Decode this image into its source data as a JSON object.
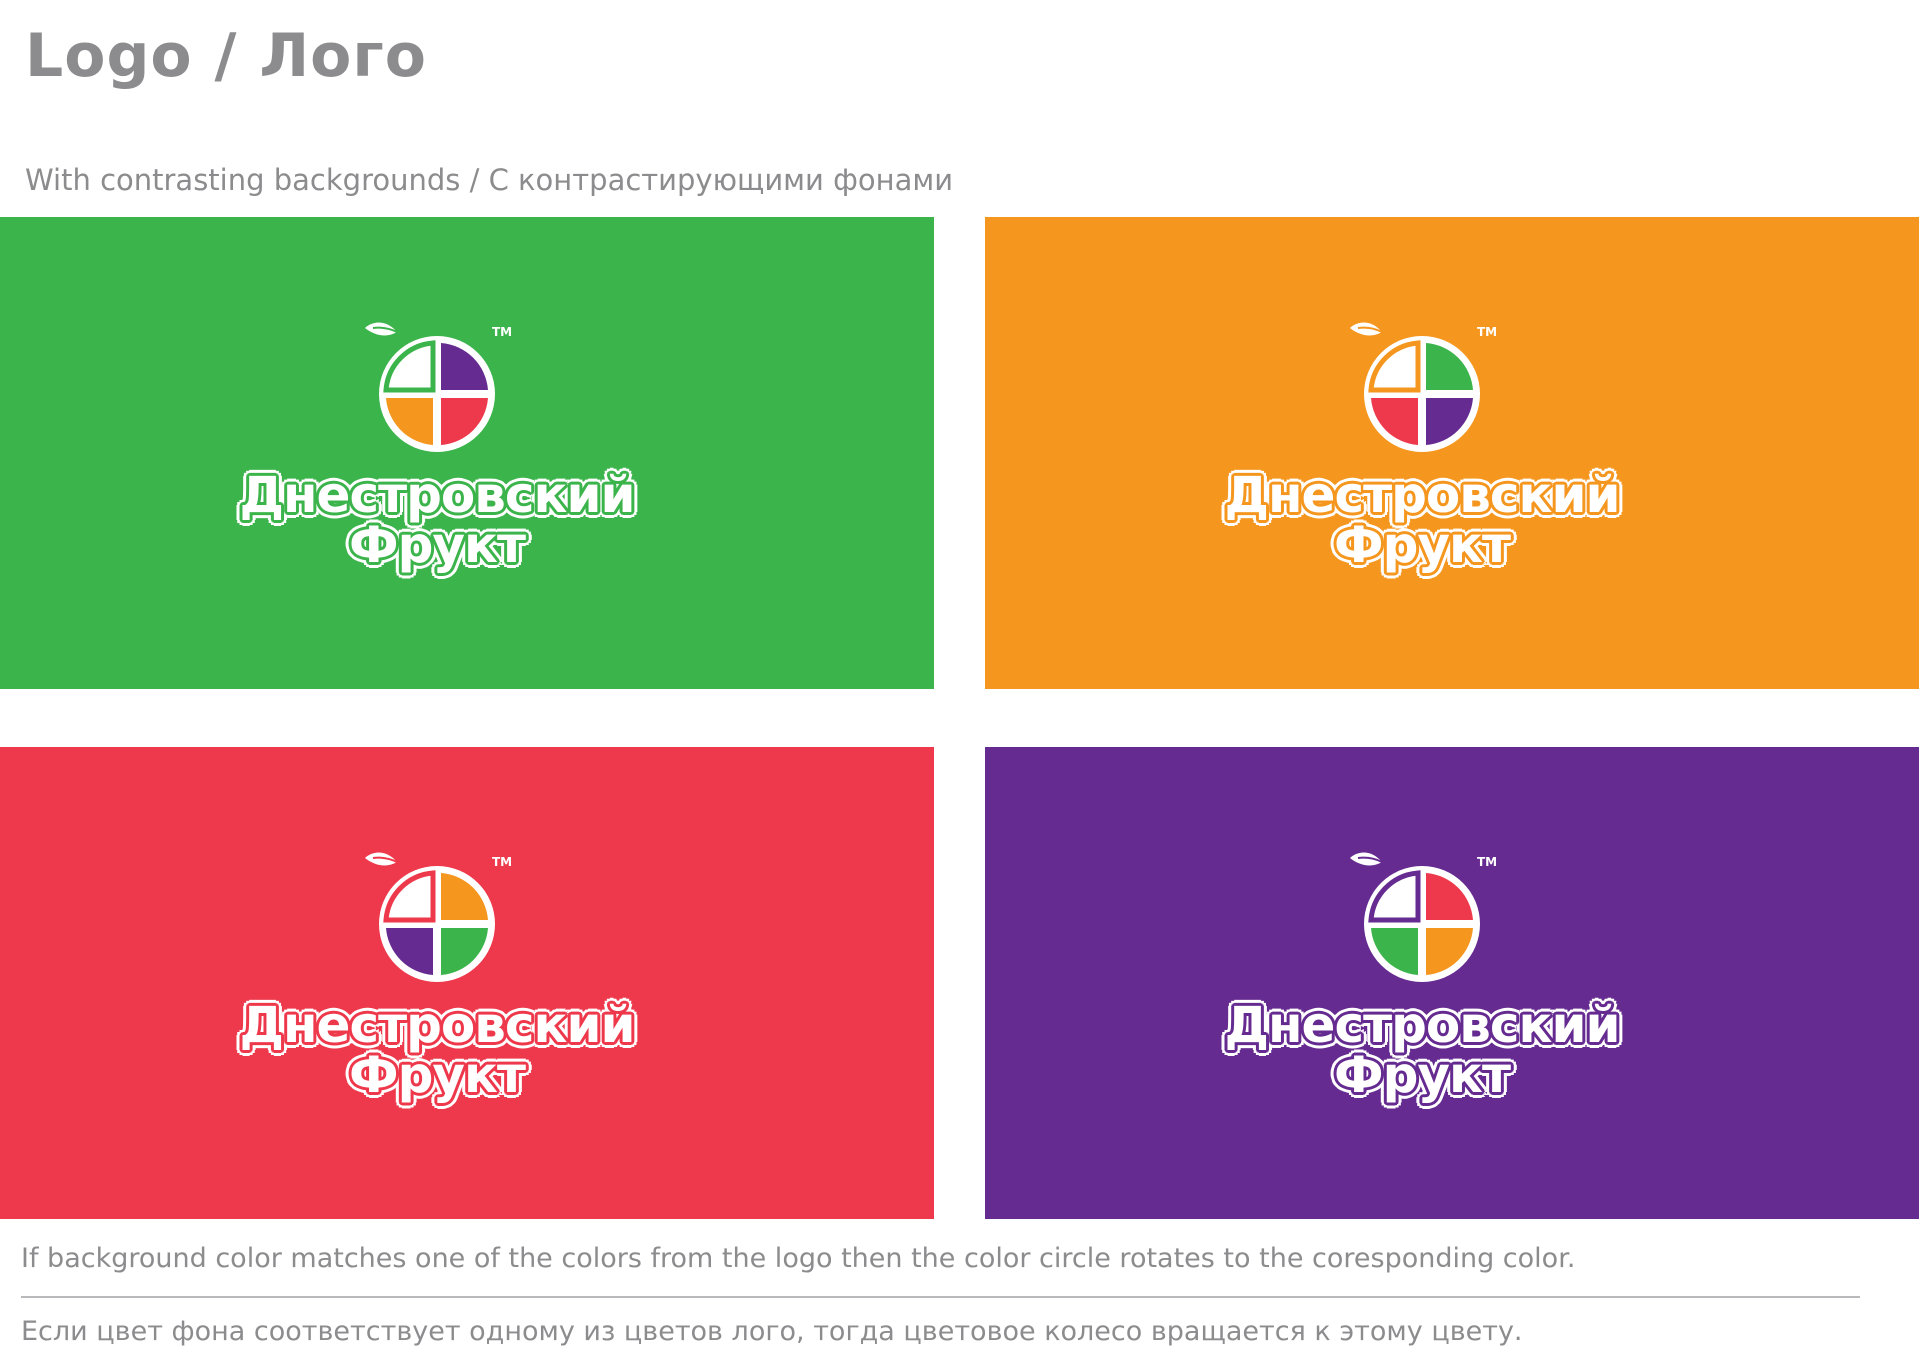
{
  "header": {
    "title": "Logo / Лого",
    "subtitle": "With contrasting backgrounds / С контрастирующими фонами"
  },
  "logo": {
    "wordmark_line1": "Днестровский",
    "wordmark_line2": "Фрукт",
    "trademark": "TM"
  },
  "palette": {
    "green": "#3bb44b",
    "orange": "#f5961f",
    "red": "#ee384b",
    "purple": "#652b90",
    "white": "#ffffff"
  },
  "panels": [
    {
      "background": "#3bb44b",
      "quadrant_top_right": "#652b90",
      "quadrant_bottom_left": "#f5961f",
      "quadrant_bottom_right": "#ee384b"
    },
    {
      "background": "#f5961f",
      "quadrant_top_right": "#3bb44b",
      "quadrant_bottom_left": "#ee384b",
      "quadrant_bottom_right": "#652b90"
    },
    {
      "background": "#ee384b",
      "quadrant_top_right": "#f5961f",
      "quadrant_bottom_left": "#652b90",
      "quadrant_bottom_right": "#3bb44b"
    },
    {
      "background": "#652b90",
      "quadrant_top_right": "#ee384b",
      "quadrant_bottom_left": "#3bb44b",
      "quadrant_bottom_right": "#f5961f"
    }
  ],
  "notes": {
    "en": "If background color matches one of the colors from the logo then the color circle rotates to the coresponding color.",
    "ru": "Если цвет фона соответствует одному из цветов лого, тогда цветовое колесо вращается к этому цвету."
  },
  "icons": {
    "leaf": "leaf-icon",
    "color_wheel": "color-wheel-icon"
  }
}
